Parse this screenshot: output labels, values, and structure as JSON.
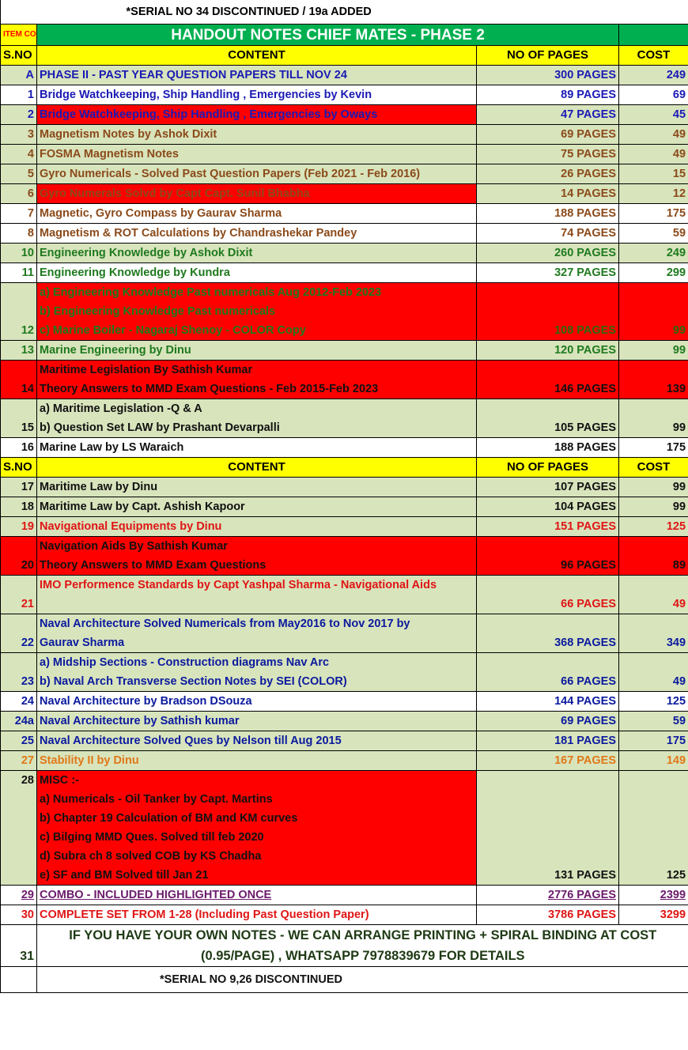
{
  "top_note": "*SERIAL NO 34 DISCONTINUED / 19a ADDED",
  "item_code_label": "ITEM CODE",
  "title": "HANDOUT NOTES CHIEF MATES - PHASE 2",
  "header": {
    "sno": "S.NO",
    "content": "CONTENT",
    "pages": "NO OF PAGES",
    "cost": "COST"
  },
  "rows": [
    {
      "sno": "A",
      "lines": [
        "PHASE II - PAST YEAR QUESTION PAPERS TILL NOV 24"
      ],
      "pages": "300 PAGES",
      "cost": "249"
    },
    {
      "sno": "1",
      "lines": [
        "Bridge Watchkeeping, Ship Handling , Emergencies by Kevin"
      ],
      "pages": "89 PAGES",
      "cost": "69"
    },
    {
      "sno": "2",
      "lines": [
        "Bridge Watchkeeping, Ship Handling , Emergencies by Oways"
      ],
      "pages": "47 PAGES",
      "cost": "45"
    },
    {
      "sno": "3",
      "lines": [
        "Magnetism Notes by Ashok Dixit"
      ],
      "pages": "69 PAGES",
      "cost": "49"
    },
    {
      "sno": "4",
      "lines": [
        "FOSMA Magnetism Notes"
      ],
      "pages": "75 PAGES",
      "cost": "49"
    },
    {
      "sno": "5",
      "lines": [
        "Gyro Numericals - Solved Past Question Papers (Feb 2021 - Feb 2016)"
      ],
      "pages": "26 PAGES",
      "cost": "15"
    },
    {
      "sno": "6",
      "lines": [
        "Gyro Numerals Solvd by Capt Capt. Sunil Bhabha"
      ],
      "pages": "14 PAGES",
      "cost": "12"
    },
    {
      "sno": "7",
      "lines": [
        "Magnetic, Gyro Compass by Gaurav Sharma"
      ],
      "pages": "188 PAGES",
      "cost": "175"
    },
    {
      "sno": "8",
      "lines": [
        "Magnetism & ROT Calculations by Chandrashekar Pandey"
      ],
      "pages": "74 PAGES",
      "cost": "59"
    },
    {
      "sno": "10",
      "lines": [
        "Engineering Knowledge by Ashok Dixit"
      ],
      "pages": "260 PAGES",
      "cost": "249"
    },
    {
      "sno": "11",
      "lines": [
        "Engineering Knowledge by Kundra"
      ],
      "pages": "327 PAGES",
      "cost": "299"
    },
    {
      "sno": "12",
      "lines": [
        "a) Engineering Knowledge Past numericals Aug 2012-Feb 2023",
        "b) Engineering Knowledge Past numericals",
        "c) Marine Boiler - Nagaraj Shenoy - COLOR Copy"
      ],
      "pages": "108 PAGES",
      "cost": "99"
    },
    {
      "sno": "13",
      "lines": [
        "Marine Engineering by Dinu"
      ],
      "pages": "120 PAGES",
      "cost": "99"
    },
    {
      "sno": "14",
      "lines": [
        "Maritime Legislation By Sathish Kumar",
        "Theory Answers to MMD Exam Questions - Feb 2015-Feb 2023"
      ],
      "pages": "146 PAGES",
      "cost": "139"
    },
    {
      "sno": "15",
      "lines": [
        "a) Maritime Legislation -Q & A",
        "b) Question Set LAW by Prashant Devarpalli"
      ],
      "pages": "105 PAGES",
      "cost": "99"
    },
    {
      "sno": "16",
      "lines": [
        "Marine Law by LS Waraich"
      ],
      "pages": "188 PAGES",
      "cost": "175"
    },
    {
      "sno": "17",
      "lines": [
        "Maritime Law by Dinu"
      ],
      "pages": "107 PAGES",
      "cost": "99"
    },
    {
      "sno": "18",
      "lines": [
        "Maritime Law by Capt. Ashish Kapoor"
      ],
      "pages": "104 PAGES",
      "cost": "99"
    },
    {
      "sno": "19",
      "lines": [
        "Navigational Equipments by Dinu"
      ],
      "pages": "151 PAGES",
      "cost": "125"
    },
    {
      "sno": "20",
      "lines": [
        "Navigation Aids By Sathish Kumar",
        "Theory Answers to MMD Exam Questions"
      ],
      "pages": "96 PAGES",
      "cost": "89"
    },
    {
      "sno": "21",
      "lines": [
        "IMO Performence Standards by Capt Yashpal Sharma - Navigational Aids",
        ""
      ],
      "pages": "66 PAGES",
      "cost": "49"
    },
    {
      "sno": "22",
      "lines": [
        "Naval Architecture Solved Numericals from May2016 to Nov 2017 by",
        "Gaurav Sharma"
      ],
      "pages": "368 PAGES",
      "cost": "349"
    },
    {
      "sno": "23",
      "lines": [
        "a) Midship Sections - Construction diagrams Nav Arc",
        "b) Naval Arch Transverse Section Notes by SEI (COLOR)"
      ],
      "pages": "66 PAGES",
      "cost": "49"
    },
    {
      "sno": "24",
      "lines": [
        "Naval Architecture by Bradson DSouza"
      ],
      "pages": "144 PAGES",
      "cost": "125"
    },
    {
      "sno": "24a",
      "lines": [
        "Naval Architecture by Sathish kumar"
      ],
      "pages": "69 PAGES",
      "cost": "59"
    },
    {
      "sno": "25",
      "lines": [
        "Naval Architecture Solved Ques by Nelson till Aug 2015"
      ],
      "pages": "181 PAGES",
      "cost": "175"
    },
    {
      "sno": "27",
      "lines": [
        "Stability II by Dinu"
      ],
      "pages": "167 PAGES",
      "cost": "149"
    },
    {
      "sno": "28",
      "lines": [
        "MISC :-",
        "a) Numericals - Oil Tanker by Capt. Martins",
        "b) Chapter 19 Calculation of BM and KM curves",
        "c) Bilging MMD Ques. Solved till feb 2020",
        "d) Subra ch 8 solved COB by KS Chadha",
        "e) SF and BM Solved till Jan 21"
      ],
      "pages": "131 PAGES",
      "cost": "125"
    },
    {
      "sno": "29",
      "lines": [
        "COMBO - INCLUDED HIGHLIGHTED ONCE"
      ],
      "pages": "2776 PAGES",
      "cost": "2399"
    },
    {
      "sno": "30",
      "lines": [
        "COMPLETE SET FROM 1-28 (Including Past Question Paper)"
      ],
      "pages": "3786 PAGES",
      "cost": "3299"
    }
  ],
  "note_row": {
    "sno": "31",
    "lines": [
      "IF YOU HAVE YOUR OWN NOTES - WE CAN ARRANGE PRINTING + SPIRAL BINDING AT COST",
      "(0.95/PAGE) , WHATSAPP 7978839679 FOR DETAILS"
    ]
  },
  "bottom_note": "*SERIAL NO 9,26 DISCONTINUED",
  "colors": {
    "title_green": "#00b050",
    "header_yellow": "#ffff00",
    "row_green": "#d8e4bc",
    "highlight_red": "#ff0000"
  }
}
